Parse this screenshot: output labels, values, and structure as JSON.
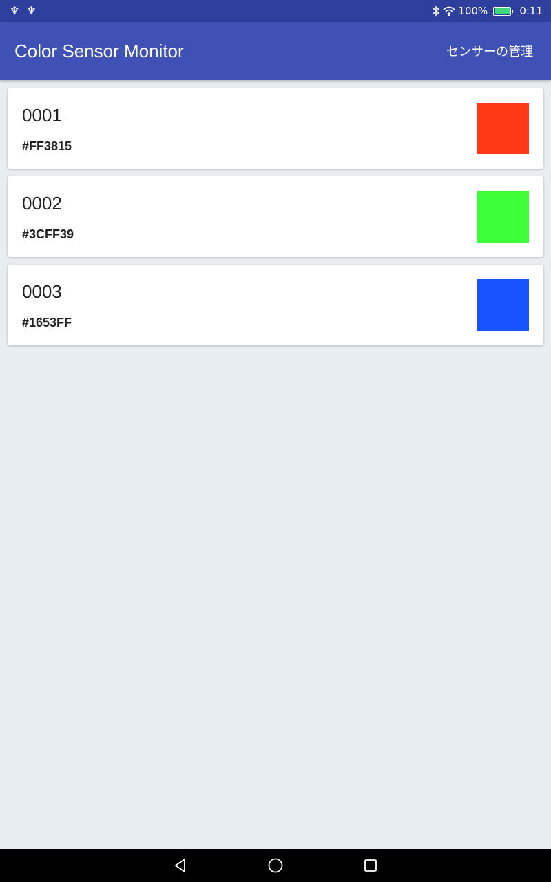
{
  "status_bar": {
    "battery_text": "100%",
    "time": "0:11",
    "left_icons": [
      "usb-icon",
      "usb-icon"
    ],
    "right_icons": [
      "bluetooth-icon",
      "wifi-icon",
      "battery-charging-icon"
    ]
  },
  "app_bar": {
    "title": "Color Sensor Monitor",
    "action_label": "センサーの管理"
  },
  "sensors": [
    {
      "id": "0001",
      "hex": "#FF3815",
      "color": "#FF3815"
    },
    {
      "id": "0002",
      "hex": "#3CFF39",
      "color": "#3CFF39"
    },
    {
      "id": "0003",
      "hex": "#1653FF",
      "color": "#1653FF"
    }
  ],
  "nav_bar": {
    "icons": [
      "back-icon",
      "home-icon",
      "recents-icon"
    ]
  },
  "colors": {
    "status_bar": "#2f3f9e",
    "app_bar": "#3f51b5",
    "background": "#e8edf1"
  }
}
